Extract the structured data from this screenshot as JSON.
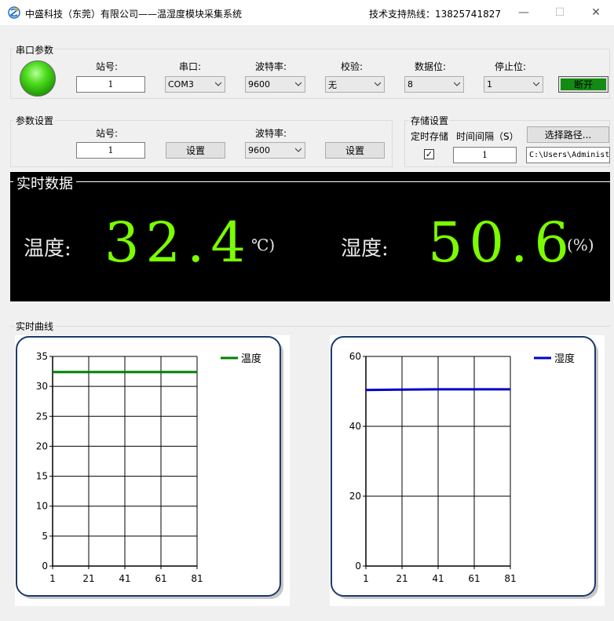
{
  "window": {
    "title": "中盛科技（东莞）有限公司——温湿度模块采集系统",
    "hotline": "技术支持热线：13825741827",
    "minimize": "—",
    "maximize": "☐",
    "close": "✕"
  },
  "serial": {
    "title": "串口参数",
    "station_label": "站号:",
    "station_value": "1",
    "port_label": "串口:",
    "port_value": "COM3",
    "baud_label": "波特率:",
    "baud_value": "9600",
    "parity_label": "校验:",
    "parity_value": "无",
    "databits_label": "数据位:",
    "databits_value": "8",
    "stopbits_label": "停止位:",
    "stopbits_value": "1",
    "disconnect_label": "断开",
    "status_color": "#2ecc1a"
  },
  "params": {
    "title": "参数设置",
    "station_label": "站号:",
    "station_value": "1",
    "set_station_label": "设置",
    "baud_label": "波特率:",
    "baud_value": "9600",
    "set_baud_label": "设置"
  },
  "storage": {
    "title": "存储设置",
    "timed_label": "定时存储",
    "timed_checked": "✓",
    "interval_label": "时间间隔（S）",
    "interval_value": "1",
    "choose_path_label": "选择路径...",
    "path_value": "C:\\Users\\Administ"
  },
  "realtime": {
    "title": "实时数据",
    "temp_label": "温度:",
    "temp_value": "32.4",
    "temp_unit": "℃)",
    "hum_label": "湿度:",
    "hum_value": "50.6",
    "hum_unit": "(%)",
    "value_color": "#7cfc00"
  },
  "curves": {
    "title": "实时曲线"
  },
  "chart_data": [
    {
      "type": "line",
      "x_ticks": [
        "1",
        "21",
        "41",
        "61",
        "81"
      ],
      "xlim": [
        1,
        81
      ],
      "ylim": [
        0,
        35
      ],
      "y_ticks": [
        "0",
        "5",
        "10",
        "15",
        "20",
        "25",
        "30",
        "35"
      ],
      "y_tick_values": [
        0,
        5,
        10,
        15,
        20,
        25,
        30,
        35
      ],
      "grid": true,
      "legend_position": "top-right",
      "series": [
        {
          "name": "温度",
          "color": "#008000",
          "x": [
            1,
            21,
            41,
            61,
            81
          ],
          "values": [
            32.4,
            32.4,
            32.4,
            32.4,
            32.4
          ]
        }
      ]
    },
    {
      "type": "line",
      "x_ticks": [
        "1",
        "21",
        "41",
        "61",
        "81"
      ],
      "xlim": [
        1,
        81
      ],
      "ylim": [
        0,
        60
      ],
      "y_ticks": [
        "0",
        "20",
        "40",
        "60"
      ],
      "y_tick_values": [
        0,
        20,
        40,
        60
      ],
      "grid": true,
      "legend_position": "top-right",
      "series": [
        {
          "name": "湿度",
          "color": "#0000cc",
          "x": [
            1,
            21,
            41,
            61,
            81
          ],
          "values": [
            50.4,
            50.5,
            50.6,
            50.6,
            50.6
          ]
        }
      ]
    }
  ]
}
